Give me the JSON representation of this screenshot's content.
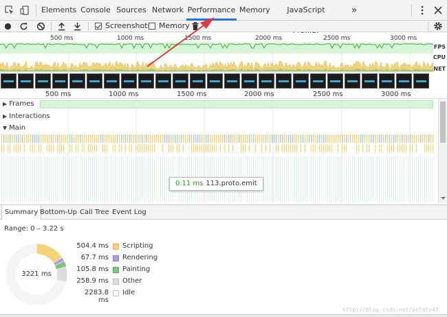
{
  "tabs": {
    "items": [
      {
        "label": "Elements"
      },
      {
        "label": "Console"
      },
      {
        "label": "Sources"
      },
      {
        "label": "Network"
      },
      {
        "label": "Performance"
      },
      {
        "label": "Memory"
      },
      {
        "label": "JavaScript Profiler"
      }
    ],
    "more_label": "»"
  },
  "toolbar": {
    "screenshots_label": "Screenshots",
    "screenshots_checked": true,
    "memory_label": "Memory",
    "memory_checked": false
  },
  "overview": {
    "ticks": [
      "500 ms",
      "1000 ms",
      "1500 ms",
      "2000 ms",
      "2500 ms",
      "3000 ms"
    ],
    "lanes": {
      "fps": "FPS",
      "cpu": "CPU",
      "net": "NET"
    }
  },
  "timeline": {
    "ticks": [
      "500 ms",
      "1000 ms",
      "1500 ms",
      "2000 ms",
      "2500 ms",
      "3000 ms"
    ],
    "rows": {
      "frames": "Frames",
      "interactions": "Interactions",
      "main": "Main"
    }
  },
  "tooltip": {
    "time": "0.11 ms",
    "name": "113.proto.emit"
  },
  "bottom_tabs": {
    "summary": "Summary",
    "bottom_up": "Bottom-Up",
    "call_tree": "Call Tree",
    "event_log": "Event Log"
  },
  "summary": {
    "range_label": "Range: 0 – 3.22 s",
    "total_label": "3221 ms",
    "items": [
      {
        "value": "504.4 ms",
        "name": "Scripting",
        "ms": 504.4,
        "color": "#f2d27a"
      },
      {
        "value": "67.7 ms",
        "name": "Rendering",
        "ms": 67.7,
        "color": "#af9bdf"
      },
      {
        "value": "105.8 ms",
        "name": "Painting",
        "ms": 105.8,
        "color": "#7fc47a"
      },
      {
        "value": "258.9 ms",
        "name": "Other",
        "ms": 258.9,
        "color": "#dddddd"
      },
      {
        "value": "2283.8 ms",
        "name": "Idle",
        "ms": 2283.8,
        "color": "#ffffff"
      }
    ]
  },
  "watermark": "http://blog.csdn.net/potato47",
  "colors": {
    "accent": "#1a73e8",
    "arrow": "#e03c3c",
    "fps": "#d6f5d6",
    "scripting": "#f2d27a",
    "painting": "#7fc47a"
  }
}
